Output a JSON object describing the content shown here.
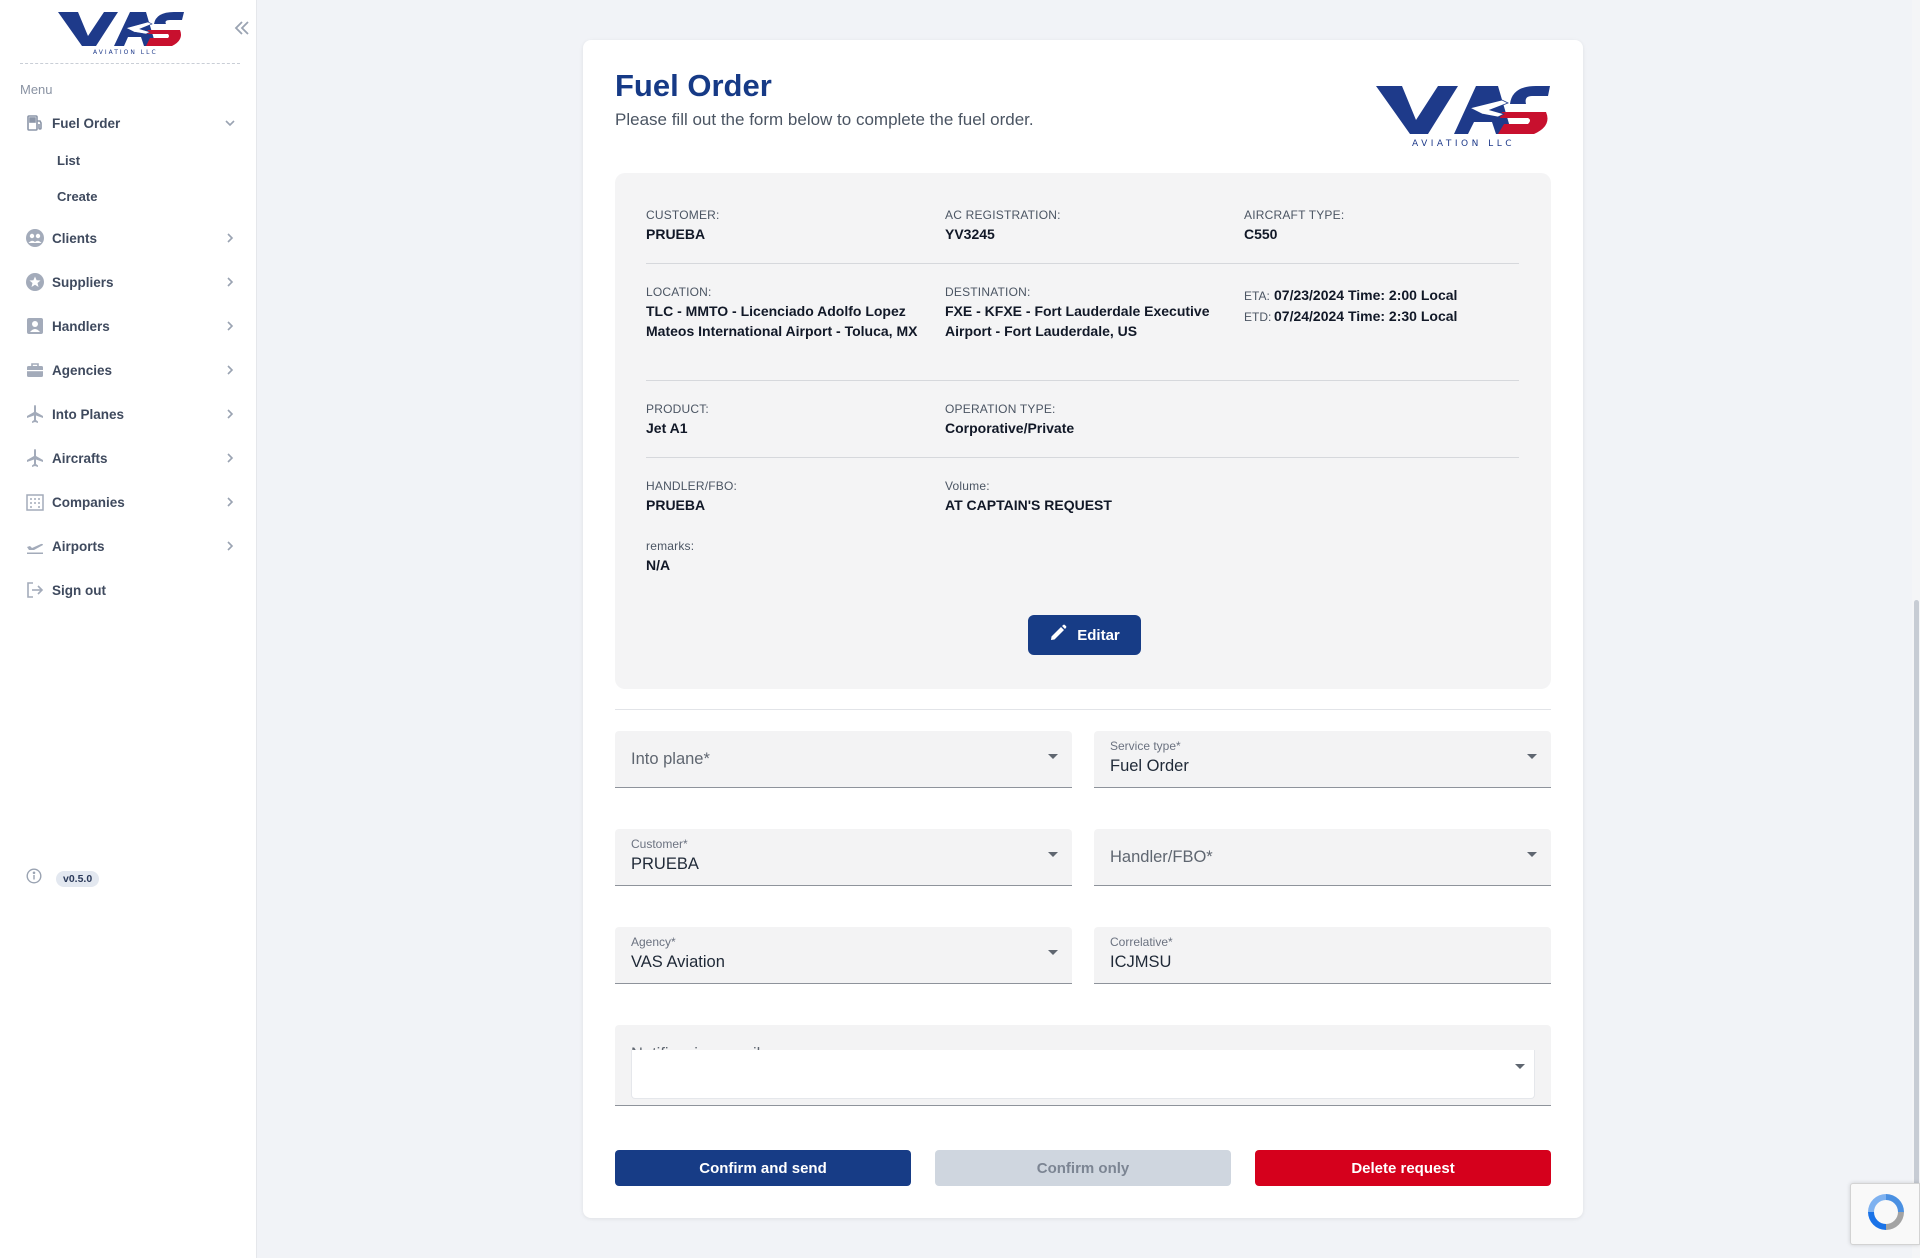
{
  "brand": {
    "name": "VAS",
    "tagline": "AVIATION LLC"
  },
  "sidebar": {
    "menu_title": "Menu",
    "items": [
      {
        "label": "Fuel Order",
        "icon": "fuel-pump-icon",
        "expanded": true
      },
      {
        "label": "Clients",
        "icon": "users-icon"
      },
      {
        "label": "Suppliers",
        "icon": "star-icon"
      },
      {
        "label": "Handlers",
        "icon": "id-badge-icon"
      },
      {
        "label": "Agencies",
        "icon": "briefcase-icon"
      },
      {
        "label": "Into Planes",
        "icon": "airplane-icon"
      },
      {
        "label": "Aircrafts",
        "icon": "airplane-icon"
      },
      {
        "label": "Companies",
        "icon": "building-icon"
      },
      {
        "label": "Airports",
        "icon": "takeoff-icon"
      },
      {
        "label": "Sign out",
        "icon": "sign-out-icon"
      }
    ],
    "sub_items": [
      {
        "label": "List"
      },
      {
        "label": "Create"
      }
    ],
    "version": "v0.5.0"
  },
  "page": {
    "title": "Fuel Order",
    "subtitle": "Please fill out the form below to complete the fuel order."
  },
  "summary": {
    "customer": {
      "label": "CUSTOMER:",
      "value": "PRUEBA"
    },
    "ac_registration": {
      "label": "AC REGISTRATION:",
      "value": "YV3245"
    },
    "aircraft_type": {
      "label": "AIRCRAFT TYPE:",
      "value": "C550"
    },
    "location": {
      "label": "LOCATION:",
      "value": "TLC - MMTO - Licenciado Adolfo Lopez Mateos International Airport - Toluca, MX"
    },
    "destination": {
      "label": "DESTINATION:",
      "value": "FXE - KFXE - Fort Lauderdale Executive Airport - Fort Lauderdale, US"
    },
    "eta": {
      "label": "ETA:",
      "value": "07/23/2024 Time: 2:00 Local"
    },
    "etd": {
      "label": "ETD:",
      "value": "07/24/2024 Time: 2:30 Local"
    },
    "product": {
      "label": "PRODUCT:",
      "value": "Jet A1"
    },
    "operation_type": {
      "label": "OPERATION TYPE:",
      "value": "Corporative/Private"
    },
    "handler": {
      "label": "HANDLER/FBO:",
      "value": "PRUEBA"
    },
    "volume": {
      "label": "Volume:",
      "value": "AT CAPTAIN'S REQUEST"
    },
    "remarks": {
      "label": "remarks:",
      "value": "N/A"
    },
    "edit_label": "Editar"
  },
  "form": {
    "into_plane": {
      "placeholder": "Into plane*",
      "value": ""
    },
    "service_type": {
      "label": "Service type*",
      "value": "Fuel Order"
    },
    "customer": {
      "label": "Customer*",
      "value": "PRUEBA"
    },
    "handler": {
      "placeholder": "Handler/FBO*",
      "value": ""
    },
    "agency": {
      "label": "Agency*",
      "value": "VAS Aviation"
    },
    "correlative": {
      "label": "Correlative*",
      "value": "ICJMSU"
    },
    "notification_email": {
      "placeholder": "Notificacion email"
    }
  },
  "actions": {
    "confirm_send": "Confirm and send",
    "confirm_only": "Confirm only",
    "delete": "Delete request"
  },
  "colors": {
    "primary": "#173c86",
    "danger": "#d5001c",
    "disabled": "#cfd6df"
  }
}
